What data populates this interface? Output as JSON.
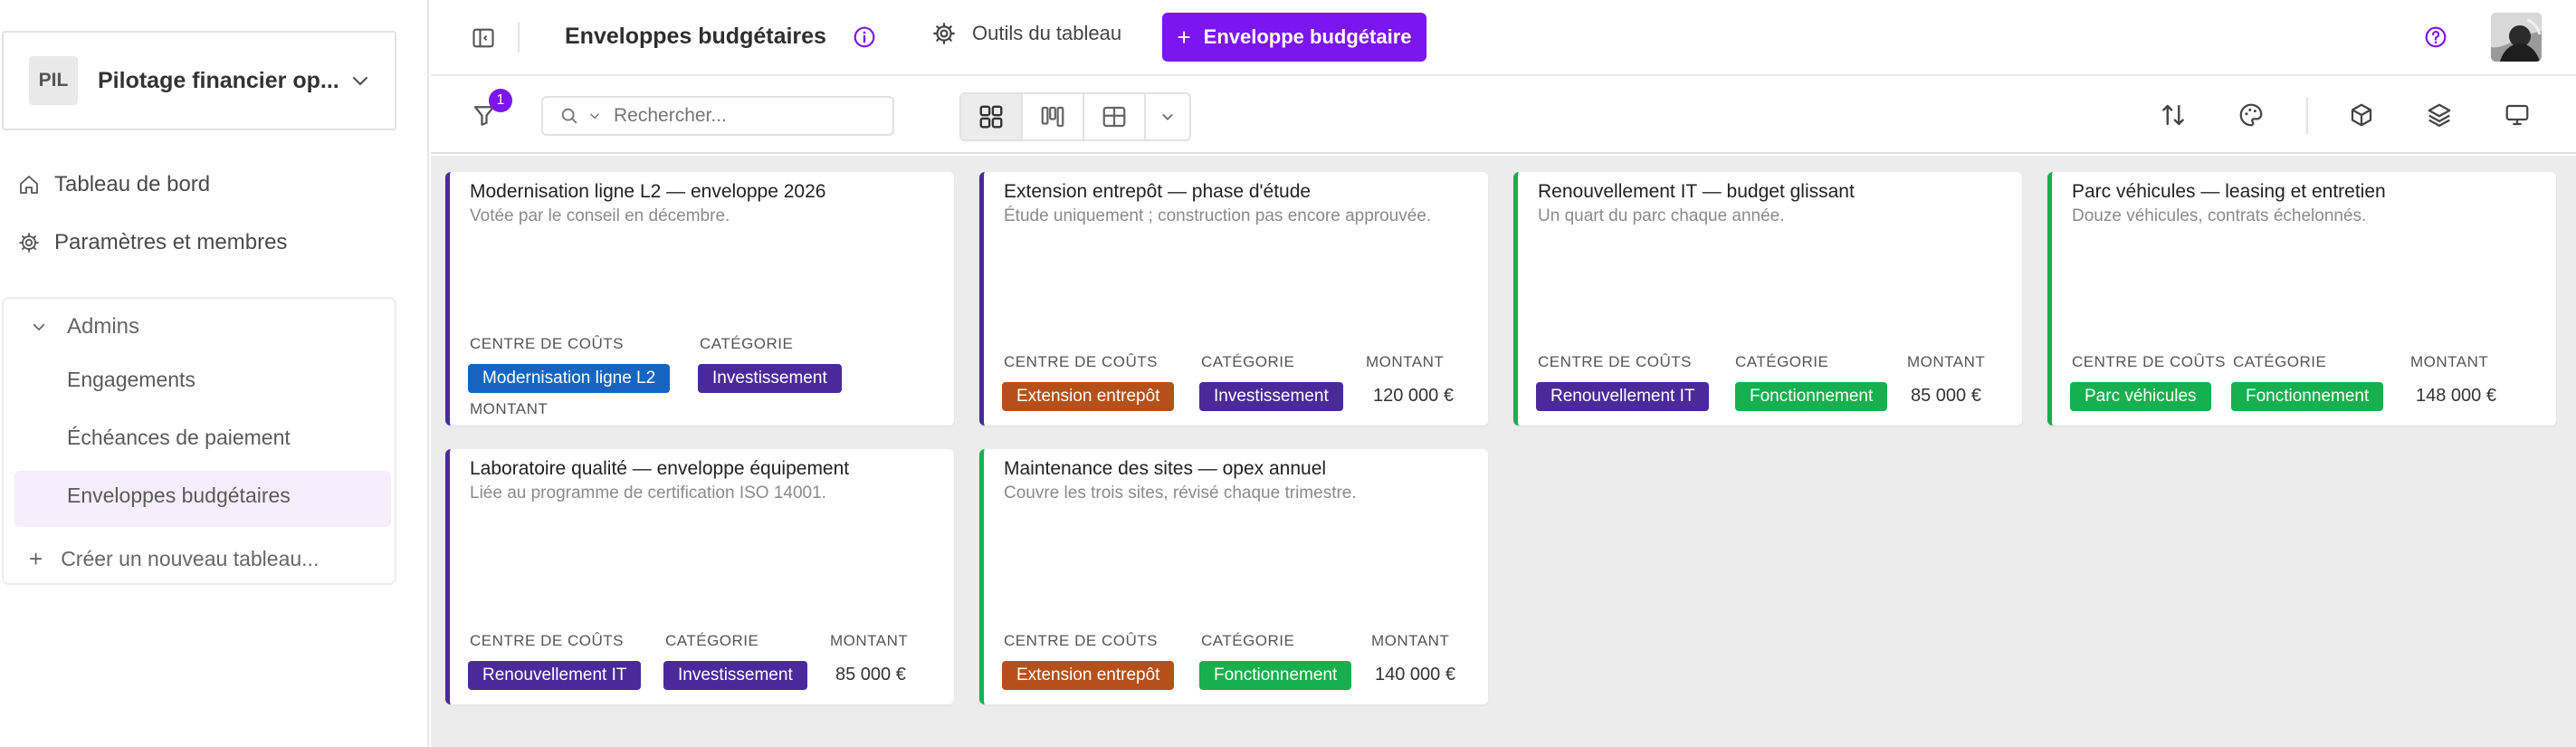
{
  "sidebar": {
    "workspace": {
      "initials": "PIL",
      "name": "Pilotage financier op..."
    },
    "nav": [
      {
        "label": "Tableau de bord",
        "icon": "home-icon"
      },
      {
        "label": "Paramètres et membres",
        "icon": "gear-icon"
      }
    ],
    "group": {
      "label": "Admins",
      "items": [
        "Engagements",
        "Échéances de paiement",
        "Enveloppes budgétaires"
      ],
      "active_index": 2,
      "create_label": "Créer un nouveau tableau..."
    }
  },
  "topbar": {
    "title": "Enveloppes budgétaires",
    "tools_label": "Outils du tableau",
    "add_label": "Enveloppe budgétaire"
  },
  "toolbar": {
    "filter_count": "1",
    "search_placeholder": "Rechercher...",
    "active_view": "gallery"
  },
  "labels": {
    "cost_center": "CENTRE DE COÛTS",
    "category": "CATÉGORIE",
    "amount": "MONTANT"
  },
  "colors": {
    "accent": "#7b16f0",
    "tag_modernisation": "#1565c0",
    "tag_investissement": "#4a2a9a",
    "tag_extension": "#b5501a",
    "tag_renouvellement": "#4a2a9a",
    "tag_fonctionnement": "#16b04e",
    "tag_parc": "#16b04e"
  },
  "cards": [
    {
      "title": "Modernisation ligne L2 — enveloppe 2026",
      "desc": "Votée par le conseil en décembre.",
      "cost_center": "Modernisation ligne L2",
      "category": "Investissement",
      "amount": ""
    },
    {
      "title": "Extension entrepôt — phase d'étude",
      "desc": "Étude uniquement ; construction pas encore approuvée.",
      "cost_center": "Extension entrepôt",
      "category": "Investissement",
      "amount": "120 000 €"
    },
    {
      "title": "Renouvellement IT — budget glissant",
      "desc": "Un quart du parc chaque année.",
      "cost_center": "Renouvellement IT",
      "category": "Fonctionnement",
      "amount": "85 000 €"
    },
    {
      "title": "Parc véhicules — leasing et entretien",
      "desc": "Douze véhicules, contrats échelonnés.",
      "cost_center": "Parc véhicules",
      "category": "Fonctionnement",
      "amount": "148 000 €"
    },
    {
      "title": "Laboratoire qualité — enveloppe équipement",
      "desc": "Liée au programme de certification ISO 14001.",
      "cost_center": "Renouvellement IT",
      "category": "Investissement",
      "amount": "85 000 €"
    },
    {
      "title": "Maintenance des sites — opex annuel",
      "desc": "Couvre les trois sites, révisé chaque trimestre.",
      "cost_center": "Extension entrepôt",
      "category": "Fonctionnement",
      "amount": "140 000 €"
    }
  ]
}
